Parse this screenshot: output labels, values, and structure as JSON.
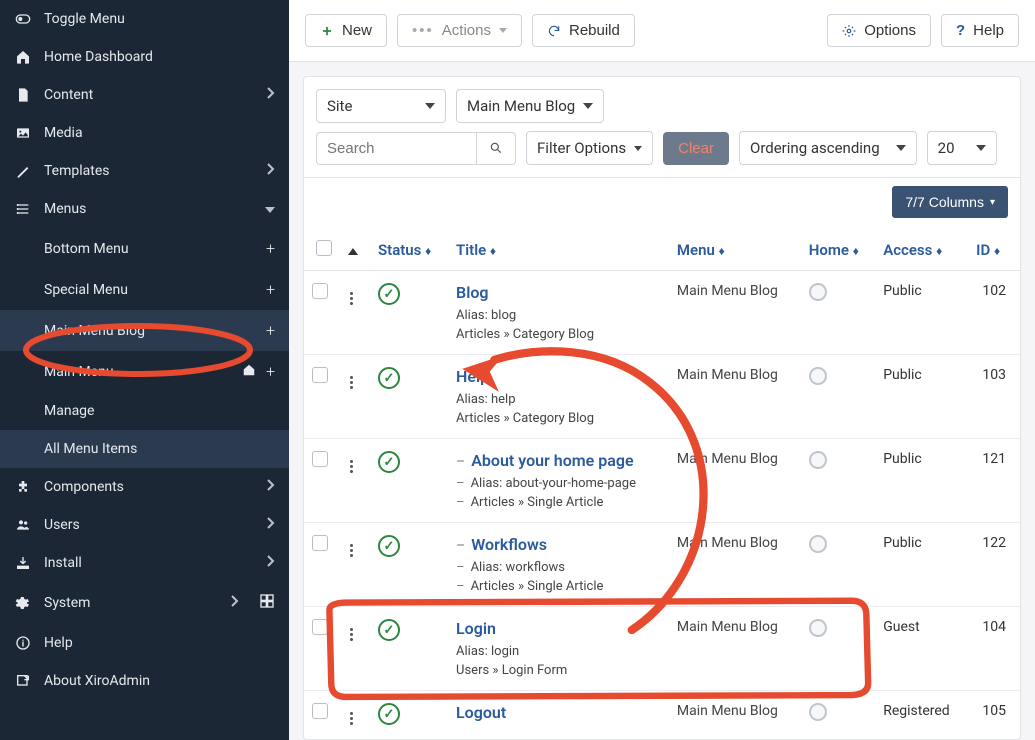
{
  "sidebar": {
    "toggle": "Toggle Menu",
    "home": "Home Dashboard",
    "content": "Content",
    "media": "Media",
    "templates": "Templates",
    "menus": "Menus",
    "menus_children": {
      "bottom": "Bottom Menu",
      "special": "Special Menu",
      "main_blog": "Main Menu Blog",
      "main_menu": "Main Menu",
      "manage": "Manage",
      "all_items": "All Menu Items"
    },
    "components": "Components",
    "users": "Users",
    "install": "Install",
    "system": "System",
    "help": "Help",
    "about": "About XiroAdmin"
  },
  "toolbar": {
    "new": "New",
    "actions": "Actions",
    "rebuild": "Rebuild",
    "options": "Options",
    "help": "Help"
  },
  "filters": {
    "site": "Site",
    "menu_select": "Main Menu Blog",
    "search_placeholder": "Search",
    "filter_options": "Filter Options",
    "clear": "Clear",
    "ordering": "Ordering ascending",
    "limit": "20",
    "columns": "7/7 Columns"
  },
  "table": {
    "headers": {
      "status": "Status",
      "title": "Title",
      "menu": "Menu",
      "home": "Home",
      "access": "Access",
      "id": "ID"
    },
    "rows": [
      {
        "title": "Blog",
        "alias": "Alias: blog",
        "path": "Articles » Category Blog",
        "indent": false,
        "menu": "Main Menu Blog",
        "access": "Public",
        "id": "102"
      },
      {
        "title": "Help",
        "alias": "Alias: help",
        "path": "Articles » Category Blog",
        "indent": false,
        "menu": "Main Menu Blog",
        "access": "Public",
        "id": "103"
      },
      {
        "title": "About your home page",
        "alias": "Alias: about-your-home-page",
        "path": "Articles » Single Article",
        "indent": true,
        "menu": "Main Menu Blog",
        "access": "Public",
        "id": "121"
      },
      {
        "title": "Workflows",
        "alias": "Alias: workflows",
        "path": "Articles » Single Article",
        "indent": true,
        "menu": "Main Menu Blog",
        "access": "Public",
        "id": "122"
      },
      {
        "title": "Login",
        "alias": "Alias: login",
        "path": "Users » Login Form",
        "indent": false,
        "menu": "Main Menu Blog",
        "access": "Guest",
        "id": "104"
      },
      {
        "title": "Logout",
        "alias": "",
        "path": "",
        "indent": false,
        "menu": "Main Menu Blog",
        "access": "Registered",
        "id": "105"
      }
    ]
  }
}
